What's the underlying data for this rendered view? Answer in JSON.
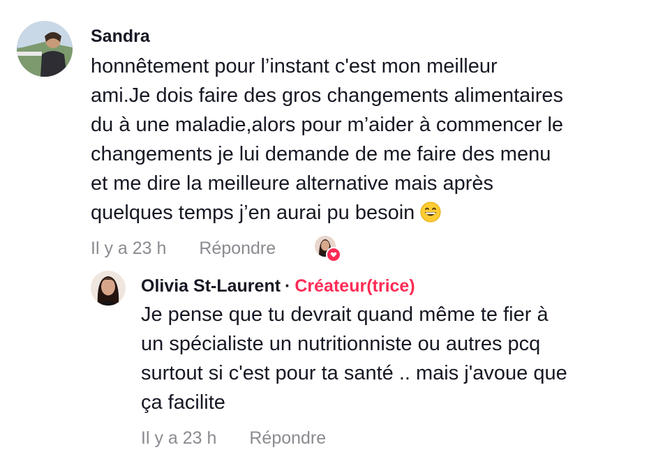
{
  "comment": {
    "username": "Sandra",
    "text_lines": [
      "honnêtement pour l’instant c'est mon meilleur",
      "ami.Je dois faire des gros changements alimentaires",
      "du à une maladie,alors pour m’aider à commencer le",
      "changements je lui demande de me faire des menu",
      "et me dire la meilleure alternative mais après",
      "quelques temps j’en aurai pu besoin"
    ],
    "emoji": "grinning-face-with-smiling-eyes",
    "time": "Il y a 23 h",
    "reply_label": "Répondre",
    "creator_liked_icon": "creator-avatar-heart-icon"
  },
  "reply": {
    "username": "Olivia St-Laurent",
    "separator": "·",
    "badge": "Créateur(trice)",
    "text_lines": [
      "Je pense que tu devrait quand même te fier à",
      "un spécialiste un nutritionniste ou autres pcq",
      "surtout si c'est pour ta santé .. mais j'avoue que",
      "ça facilite"
    ],
    "time": "Il y a 23 h",
    "reply_label": "Répondre"
  },
  "colors": {
    "text": "#161823",
    "muted": "#8a8b91",
    "accent": "#fe2c55"
  }
}
